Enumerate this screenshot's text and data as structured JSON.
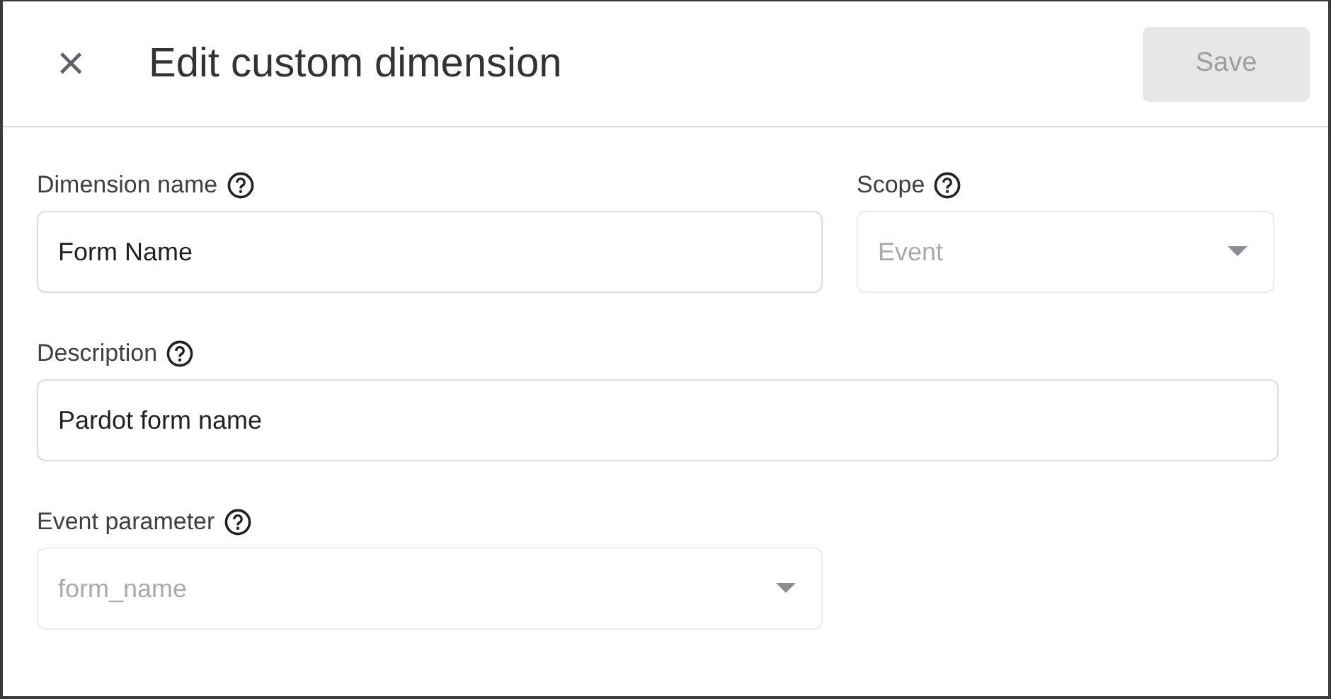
{
  "dialog": {
    "title": "Edit custom dimension",
    "close_icon": "×",
    "save_button": {
      "label": "Save",
      "disabled": true
    }
  },
  "rows": [
    {
      "fields": [
        {
          "kind": "text",
          "label": "Dimension name",
          "value": "Form Name",
          "disabled": false
        },
        {
          "kind": "select",
          "label": "Scope",
          "value": "Event",
          "disabled": true
        }
      ]
    },
    {
      "fields": [
        {
          "kind": "text",
          "label": "Description",
          "value": "Pardot form name",
          "disabled": false
        }
      ]
    },
    {
      "fields": [
        {
          "kind": "select",
          "label": "Event parameter",
          "value": "form_name",
          "disabled": true
        }
      ]
    }
  ]
}
